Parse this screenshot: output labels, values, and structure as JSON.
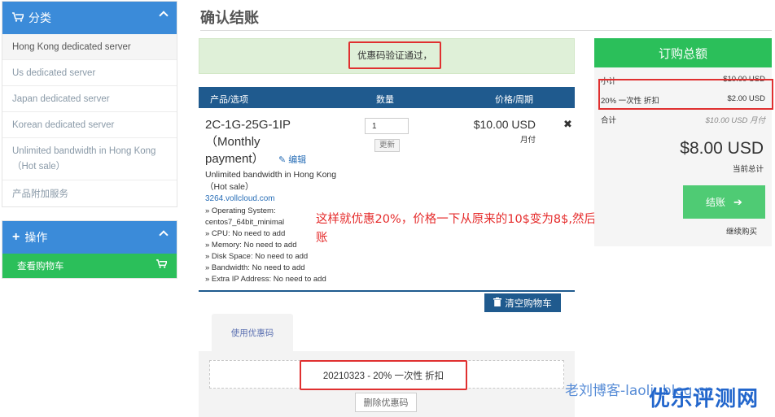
{
  "sidebar": {
    "category_title": "分类",
    "categories": [
      "Hong Kong dedicated server",
      "Us dedicated server",
      "Japan dedicated server",
      "Korean dedicated server",
      "Unlimited bandwidth in Hong Kong（Hot sale）",
      "产品附加服务"
    ],
    "actions_title": "操作",
    "view_cart": "查看购物车"
  },
  "page": {
    "title": "确认结账",
    "alert": "优惠码验证通过，"
  },
  "table": {
    "col_product": "产品/选项",
    "col_qty": "数量",
    "col_price": "价格/周期"
  },
  "item": {
    "name": "2C-1G-25G-1IP（Monthly payment）",
    "edit": "编辑",
    "group": "Unlimited bandwidth in Hong Kong（Hot sale）",
    "domain": "3264.vollcloud.com",
    "options": [
      "» Operating System: centos7_64bit_minimal",
      "» CPU: No need to add",
      "» Memory: No need to add",
      "» Disk Space: No need to add",
      "» Bandwidth: No need to add",
      "» Extra IP Address: No need to add"
    ],
    "qty": "1",
    "update": "更新",
    "price": "$10.00 USD",
    "cycle": "月付",
    "remove": "✖"
  },
  "annotation": "这样就优惠20%，价格一下从原来的10$变为8$,然后选择下一步结账",
  "cart_actions": {
    "clear": "清空购物车"
  },
  "promo": {
    "tab": "使用优惠码",
    "applied": "20210323 - 20% 一次性 折扣",
    "remove": "删除优惠码"
  },
  "summary": {
    "title": "订购总额",
    "subtotal_label": "小计",
    "subtotal_value": "$10.00 USD",
    "discount_label": "20% 一次性 折扣",
    "discount_value": "$2.00 USD",
    "total_label": "合计",
    "recurring_value": "$10.00 USD 月付",
    "total_due": "$8.00 USD",
    "total_due_label": "当前总计",
    "checkout": "结账",
    "continue": "继续购买"
  },
  "watermark": {
    "blog": "老刘博客-laoliublog.cn",
    "brand": "优乐评测网"
  },
  "colors": {
    "sidebar_blue": "#3b8bd9",
    "table_navy": "#1f5a8e",
    "green": "#2bbf5a",
    "highlight_red": "#e03030"
  }
}
